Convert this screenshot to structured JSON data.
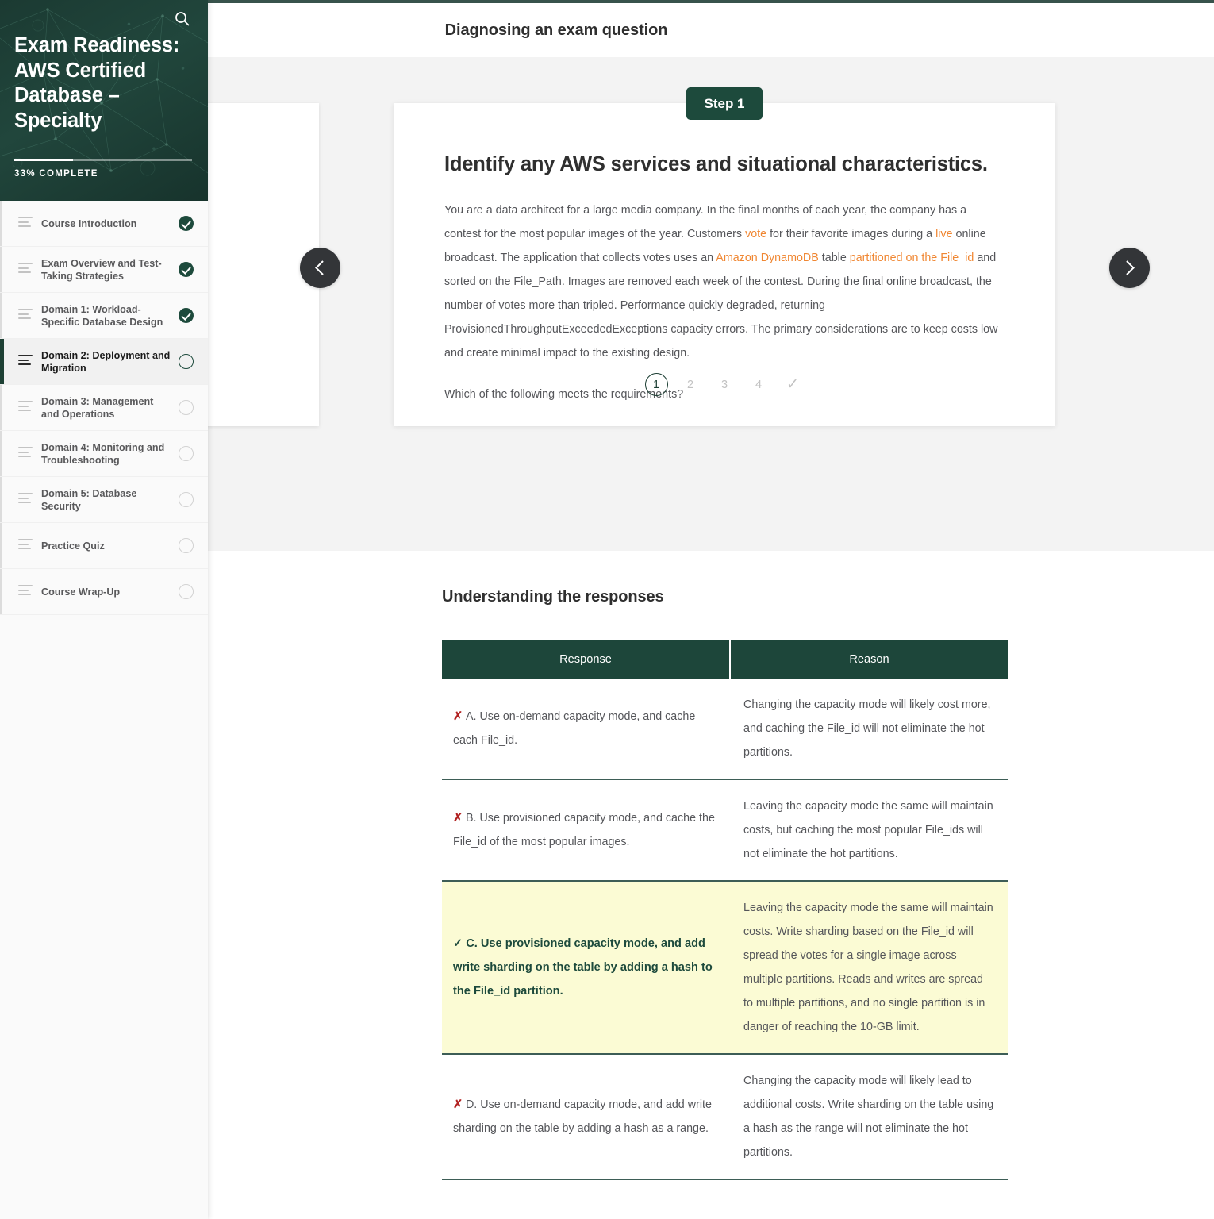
{
  "sidebar": {
    "search_icon": "search-icon",
    "course_title": "Exam Readiness: AWS Certified Database – Specialty",
    "progress_percent": 33,
    "progress_label": "33% COMPLETE",
    "items": [
      {
        "label": "Course Introduction",
        "status": "done"
      },
      {
        "label": "Exam Overview and Test-Taking Strategies",
        "status": "done"
      },
      {
        "label": "Domain 1: Workload-Specific Database Design",
        "status": "done"
      },
      {
        "label": "Domain 2: Deployment and Migration",
        "status": "open",
        "active": true
      },
      {
        "label": "Domain 3: Management and Operations",
        "status": "empty"
      },
      {
        "label": "Domain 4: Monitoring and Troubleshooting",
        "status": "empty"
      },
      {
        "label": "Domain 5: Database Security",
        "status": "empty"
      },
      {
        "label": "Practice Quiz",
        "status": "empty"
      },
      {
        "label": "Course Wrap-Up",
        "status": "empty"
      }
    ]
  },
  "header": {
    "title": "Diagnosing an exam question"
  },
  "carousel": {
    "step_badge": "Step 1",
    "prev_icon": "chevron-left-icon",
    "next_icon": "chevron-right-icon",
    "card": {
      "heading": "Identify any AWS services and situational characteristics.",
      "paragraph_parts": [
        {
          "text": "You are a data architect for a large media company. In the final months of each year, the company has a contest for the most popular images of the year. Customers ",
          "highlight": false
        },
        {
          "text": "vote",
          "highlight": true
        },
        {
          "text": " for their favorite images during a ",
          "highlight": false
        },
        {
          "text": "live",
          "highlight": true
        },
        {
          "text": " online broadcast. The application that collects votes uses an ",
          "highlight": false
        },
        {
          "text": "Amazon DynamoDB",
          "highlight": true
        },
        {
          "text": " table ",
          "highlight": false
        },
        {
          "text": "partitioned on the File_id",
          "highlight": true
        },
        {
          "text": " and sorted on the File_Path. Images are removed each week of the contest. During the final online broadcast, the number of votes more than tripled. Performance quickly degraded, returning ProvisionedThroughputExceededExceptions capacity errors. The primary considerations are to keep costs low and create minimal impact to the existing design.",
          "highlight": false
        }
      ],
      "question": "Which of the following meets the requirements?"
    },
    "pagination": {
      "steps": [
        "1",
        "2",
        "3",
        "4"
      ],
      "current": "1",
      "check_icon": "check-icon"
    }
  },
  "responses": {
    "title": "Understanding the responses",
    "columns": [
      "Response",
      "Reason"
    ],
    "rows": [
      {
        "mark": "✗",
        "correct": false,
        "response": "A. Use on-demand capacity mode, and cache each File_id.",
        "reason": "Changing the capacity mode will likely cost more, and caching the File_id will not eliminate the hot partitions."
      },
      {
        "mark": "✗",
        "correct": false,
        "response": "B. Use provisioned capacity mode, and cache the File_id of the most popular images.",
        "reason": "Leaving the capacity mode the same will maintain costs, but caching the most popular File_ids will not eliminate the hot partitions."
      },
      {
        "mark": "✓",
        "correct": true,
        "response": "C. Use provisioned capacity mode, and add write sharding on the table by adding a hash to the File_id partition.",
        "reason": "Leaving the capacity mode the same will maintain costs. Write sharding based on the File_id will spread the votes for a single image across multiple partitions. Reads and writes are spread to multiple partitions, and no single partition is in danger of reaching the 10-GB limit."
      },
      {
        "mark": "✗",
        "correct": false,
        "response": "D. Use on-demand capacity mode, and add write sharding on the table by adding a hash as a range.",
        "reason": "Changing the capacity mode will likely lead to additional costs. Write sharding on the table using a hash as the range will not eliminate the hot partitions."
      }
    ]
  },
  "colors": {
    "brand_green": "#1d4a3c",
    "accent_orange": "#f08733",
    "highlight_yellow": "#fbfbd4",
    "incorrect_red": "#b22222",
    "arrow_dark": "#333538"
  }
}
